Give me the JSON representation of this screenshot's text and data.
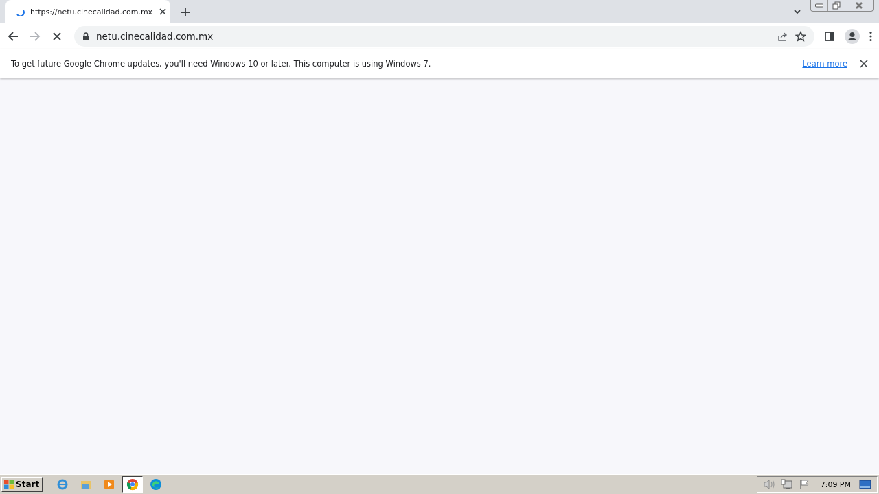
{
  "tab": {
    "title": "https://netu.cinecalidad.com.mx",
    "loading": true
  },
  "address_bar": {
    "value": "netu.cinecalidad.com.mx"
  },
  "infobar": {
    "message": "To get future Google Chrome updates, you'll need Windows 10 or later. This computer is using Windows 7.",
    "link": "Learn more"
  },
  "taskbar": {
    "start_label": "Start",
    "apps": [
      {
        "kind": "ie",
        "selected": false
      },
      {
        "kind": "folder",
        "selected": false
      },
      {
        "kind": "media",
        "selected": false
      },
      {
        "kind": "chrome",
        "selected": true
      },
      {
        "kind": "edge",
        "selected": false
      }
    ],
    "clock": "7:09 PM"
  }
}
